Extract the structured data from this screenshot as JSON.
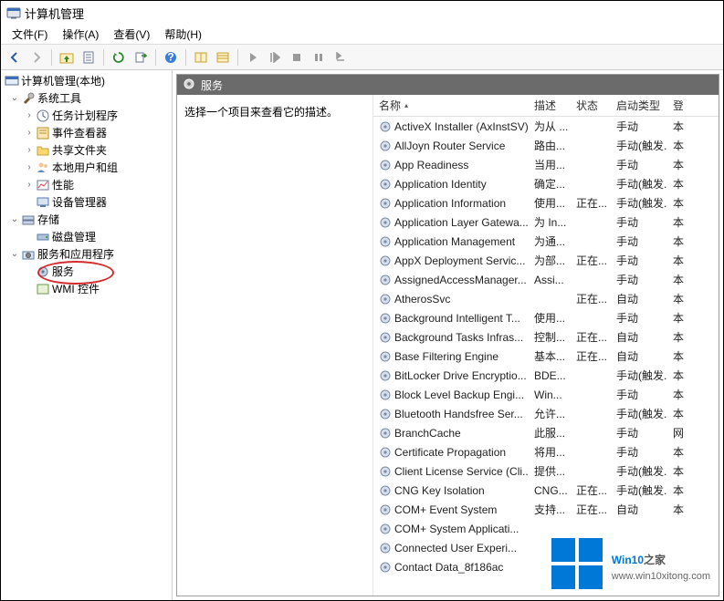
{
  "window": {
    "title": "计算机管理"
  },
  "menubar": {
    "file": "文件(F)",
    "action": "操作(A)",
    "view": "查看(V)",
    "help": "帮助(H)"
  },
  "toolbar_icons": {
    "back": "back-icon",
    "forward": "forward-icon",
    "up_folder": "up-folder-icon",
    "properties": "properties-icon",
    "refresh": "refresh-icon",
    "export": "export-icon",
    "help": "help-icon",
    "columns": "columns-icon",
    "play": "play-icon",
    "stop": "stop-icon",
    "pause": "pause-icon",
    "restart": "restart-icon"
  },
  "tree": {
    "root": "计算机管理(本地)",
    "system_tools": "系统工具",
    "system_children": {
      "task_scheduler": "任务计划程序",
      "event_viewer": "事件查看器",
      "shared_folders": "共享文件夹",
      "local_users": "本地用户和组",
      "performance": "性能",
      "device_manager": "设备管理器"
    },
    "storage": "存储",
    "storage_children": {
      "disk_management": "磁盘管理"
    },
    "services_apps": "服务和应用程序",
    "services_children": {
      "services": "服务",
      "wmi": "WMI 控件"
    }
  },
  "services_pane": {
    "header": "服务",
    "detail_prompt": "选择一个项目来查看它的描述。",
    "columns": {
      "name": "名称",
      "desc": "描述",
      "status": "状态",
      "startup": "启动类型",
      "logon": "登"
    }
  },
  "services": [
    {
      "name": "ActiveX Installer (AxInstSV)",
      "desc": "为从 ...",
      "status": "",
      "startup": "手动",
      "logon": "本"
    },
    {
      "name": "AllJoyn Router Service",
      "desc": "路由...",
      "status": "",
      "startup": "手动(触发...",
      "logon": "本"
    },
    {
      "name": "App Readiness",
      "desc": "当用...",
      "status": "",
      "startup": "手动",
      "logon": "本"
    },
    {
      "name": "Application Identity",
      "desc": "确定...",
      "status": "",
      "startup": "手动(触发...",
      "logon": "本"
    },
    {
      "name": "Application Information",
      "desc": "使用...",
      "status": "正在...",
      "startup": "手动(触发...",
      "logon": "本"
    },
    {
      "name": "Application Layer Gatewa...",
      "desc": "为 In...",
      "status": "",
      "startup": "手动",
      "logon": "本"
    },
    {
      "name": "Application Management",
      "desc": "为通...",
      "status": "",
      "startup": "手动",
      "logon": "本"
    },
    {
      "name": "AppX Deployment Servic...",
      "desc": "为部...",
      "status": "正在...",
      "startup": "手动",
      "logon": "本"
    },
    {
      "name": "AssignedAccessManager...",
      "desc": "Assi...",
      "status": "",
      "startup": "手动",
      "logon": "本"
    },
    {
      "name": "AtherosSvc",
      "desc": "",
      "status": "正在...",
      "startup": "自动",
      "logon": "本"
    },
    {
      "name": "Background Intelligent T...",
      "desc": "使用...",
      "status": "",
      "startup": "手动",
      "logon": "本"
    },
    {
      "name": "Background Tasks Infras...",
      "desc": "控制...",
      "status": "正在...",
      "startup": "自动",
      "logon": "本"
    },
    {
      "name": "Base Filtering Engine",
      "desc": "基本...",
      "status": "正在...",
      "startup": "自动",
      "logon": "本"
    },
    {
      "name": "BitLocker Drive Encryptio...",
      "desc": "BDE...",
      "status": "",
      "startup": "手动(触发...",
      "logon": "本"
    },
    {
      "name": "Block Level Backup Engi...",
      "desc": "Win...",
      "status": "",
      "startup": "手动",
      "logon": "本"
    },
    {
      "name": "Bluetooth Handsfree Ser...",
      "desc": "允许...",
      "status": "",
      "startup": "手动(触发...",
      "logon": "本"
    },
    {
      "name": "BranchCache",
      "desc": "此服...",
      "status": "",
      "startup": "手动",
      "logon": "网"
    },
    {
      "name": "Certificate Propagation",
      "desc": "将用...",
      "status": "",
      "startup": "手动",
      "logon": "本"
    },
    {
      "name": "Client License Service (Cli...",
      "desc": "提供...",
      "status": "",
      "startup": "手动(触发...",
      "logon": "本"
    },
    {
      "name": "CNG Key Isolation",
      "desc": "CNG...",
      "status": "正在...",
      "startup": "手动(触发...",
      "logon": "本"
    },
    {
      "name": "COM+ Event System",
      "desc": "支持...",
      "status": "正在...",
      "startup": "自动",
      "logon": "本"
    },
    {
      "name": "COM+ System Applicati...",
      "desc": "",
      "status": "",
      "startup": "",
      "logon": ""
    },
    {
      "name": "Connected User Experi...",
      "desc": "",
      "status": "",
      "startup": "",
      "logon": ""
    },
    {
      "name": "Contact Data_8f186ac",
      "desc": "",
      "status": "",
      "startup": "",
      "logon": ""
    }
  ],
  "watermark": {
    "brand": "Win10",
    "suffix": "之家",
    "url": "www.win10xitong.com"
  }
}
